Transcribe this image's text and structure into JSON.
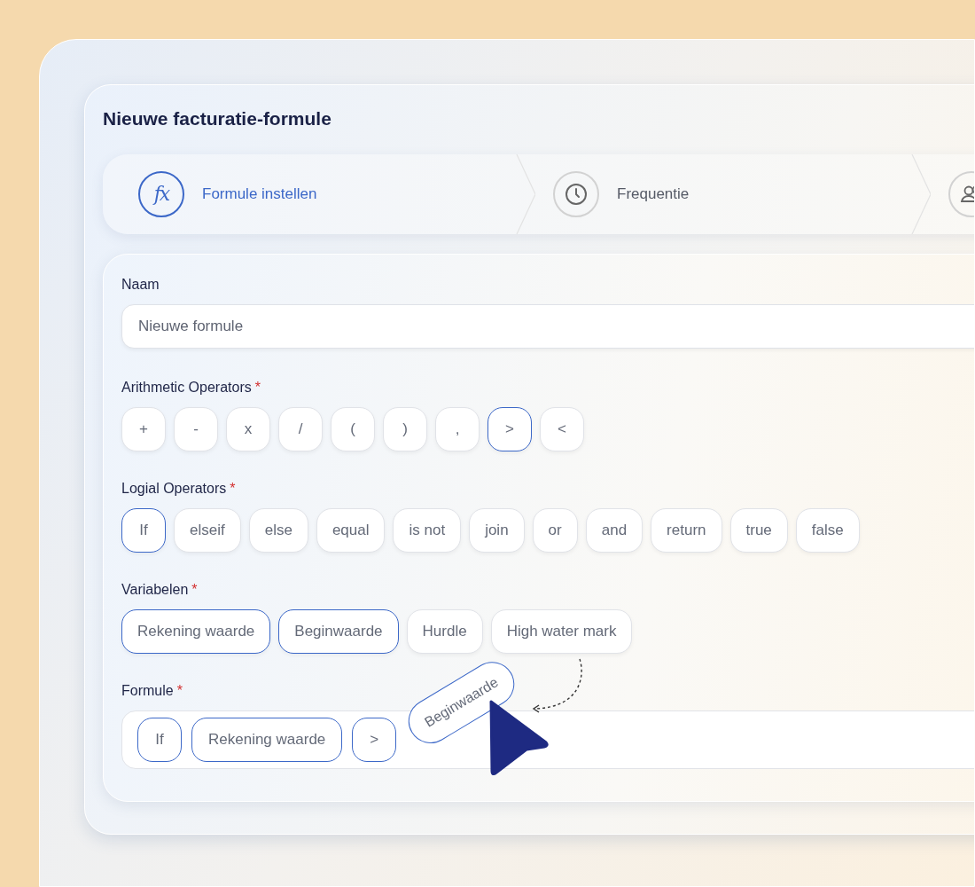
{
  "dialog": {
    "title": "Nieuwe facturatie-formule"
  },
  "steps": [
    {
      "label": "Formule instellen",
      "icon_text": "fx",
      "selected": true
    },
    {
      "label": "Frequentie",
      "selected": false
    },
    {
      "selected": false
    }
  ],
  "name_field": {
    "label": "Naam",
    "placeholder": "Nieuwe formule"
  },
  "groups": [
    {
      "label": "Arithmetic Operators",
      "required_mark": "*",
      "chips": [
        {
          "text": "+",
          "selected": false
        },
        {
          "text": "-",
          "selected": false
        },
        {
          "text": "x",
          "selected": false
        },
        {
          "text": "/",
          "selected": false
        },
        {
          "text": "(",
          "selected": false
        },
        {
          "text": ")",
          "selected": false
        },
        {
          "text": ",",
          "selected": false
        },
        {
          "text": ">",
          "selected": true
        },
        {
          "text": "<",
          "selected": false
        }
      ]
    },
    {
      "label": "Logial Operators",
      "required_mark": "*",
      "chips": [
        {
          "text": "If",
          "selected": true
        },
        {
          "text": "elseif",
          "selected": false
        },
        {
          "text": "else",
          "selected": false
        },
        {
          "text": "equal",
          "selected": false
        },
        {
          "text": "is not",
          "selected": false
        },
        {
          "text": "join",
          "selected": false
        },
        {
          "text": "or",
          "selected": false
        },
        {
          "text": "and",
          "selected": false
        },
        {
          "text": "return",
          "selected": false
        },
        {
          "text": "true",
          "selected": false
        },
        {
          "text": "false",
          "selected": false
        }
      ]
    },
    {
      "label": "Variabelen",
      "required_mark": "*",
      "chips": [
        {
          "text": "Rekening waarde",
          "selected": true
        },
        {
          "text": "Beginwaarde",
          "selected": true
        },
        {
          "text": "Hurdle",
          "selected": false
        },
        {
          "text": "High water mark",
          "selected": false
        }
      ]
    }
  ],
  "formula": {
    "label": "Formule",
    "required_mark": "*",
    "tokens": [
      "If",
      "Rekening waarde",
      ">"
    ],
    "dragged_token": "Beginwaarde"
  }
}
